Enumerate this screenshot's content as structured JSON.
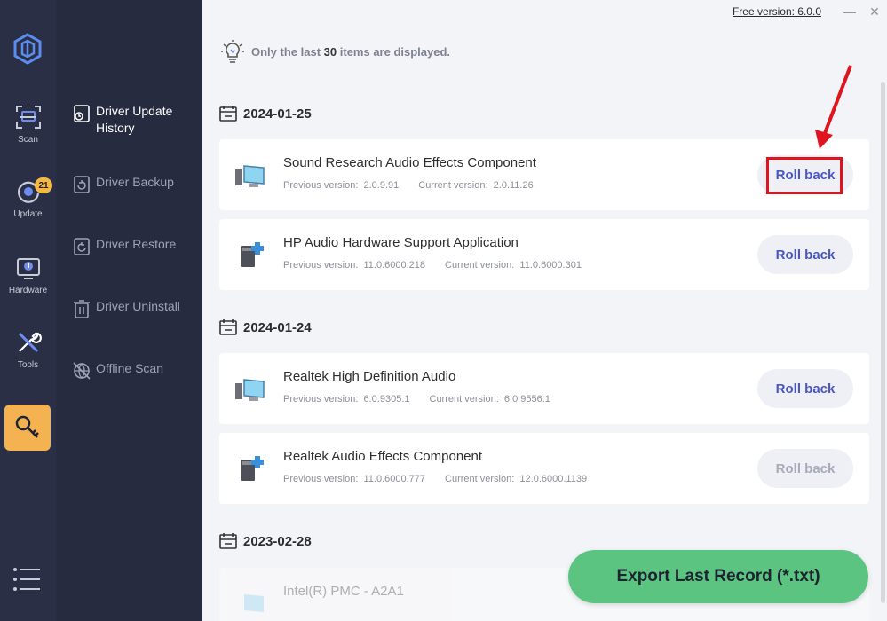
{
  "rail": {
    "items": [
      {
        "label": "Scan",
        "icon": "scan-icon"
      },
      {
        "label": "Update",
        "icon": "update-icon",
        "badge": "21"
      },
      {
        "label": "Hardware",
        "icon": "hardware-icon"
      },
      {
        "label": "Tools",
        "icon": "tools-icon"
      }
    ],
    "active_icon": "key-icon",
    "accent": "#f4b350"
  },
  "sidebar": {
    "items": [
      {
        "label": "Driver Update History",
        "icon": "history-icon",
        "active": true
      },
      {
        "label": "Driver Backup",
        "icon": "backup-icon"
      },
      {
        "label": "Driver Restore",
        "icon": "restore-icon"
      },
      {
        "label": "Driver Uninstall",
        "icon": "uninstall-icon"
      },
      {
        "label": "Offline Scan",
        "icon": "offline-scan-icon"
      }
    ]
  },
  "topbar": {
    "version": "Free version: 6.0.0",
    "minimize": "—",
    "close": "✕"
  },
  "notice": {
    "prefix": "Only the last",
    "count": "30",
    "suffix": "items are displayed."
  },
  "groups": [
    {
      "date": "2024-01-25",
      "entries": [
        {
          "name": "Sound Research Audio Effects Component",
          "prev_label": "Previous version:",
          "prev": "2.0.9.91",
          "cur_label": "Current version:",
          "cur": "2.0.11.26",
          "button": "Roll back",
          "enabled": true,
          "highlighted": true
        },
        {
          "name": "HP Audio Hardware Support Application",
          "prev_label": "Previous version:",
          "prev": "11.0.6000.218",
          "cur_label": "Current version:",
          "cur": "11.0.6000.301",
          "button": "Roll back",
          "enabled": true
        }
      ]
    },
    {
      "date": "2024-01-24",
      "entries": [
        {
          "name": "Realtek High Definition Audio",
          "prev_label": "Previous version:",
          "prev": "6.0.9305.1",
          "cur_label": "Current version:",
          "cur": "6.0.9556.1",
          "button": "Roll back",
          "enabled": true
        },
        {
          "name": "Realtek Audio Effects Component",
          "prev_label": "Previous version:",
          "prev": "11.0.6000.777",
          "cur_label": "Current version:",
          "cur": "12.0.6000.1139",
          "button": "Roll back",
          "enabled": false
        }
      ]
    },
    {
      "date": "2023-02-28",
      "entries": [
        {
          "name": "Intel(R) PMC - A2A1"
        }
      ]
    }
  ],
  "export": {
    "label": "Export Last Record (*.txt)",
    "color": "#5cc481"
  },
  "colors": {
    "rail": "#2a2f45",
    "sidebar": "#262b40",
    "main_bg": "#f3f4f8",
    "roll_back": "#4a56c2",
    "highlight": "#e0141e"
  }
}
